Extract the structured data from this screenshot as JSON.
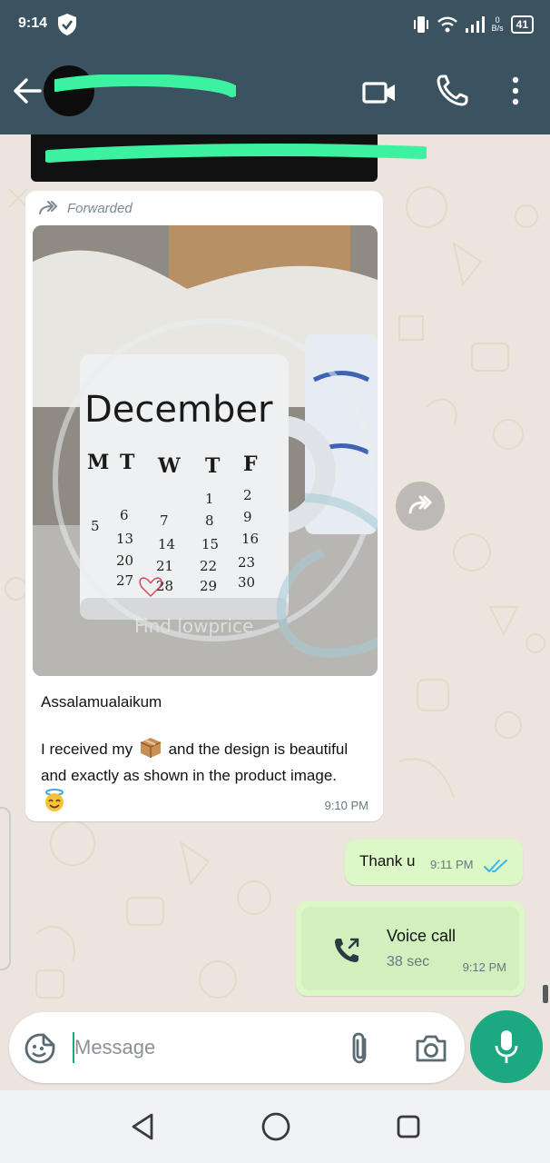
{
  "status_bar": {
    "time": "9:14",
    "network_speed_value": "0",
    "network_speed_unit": "B/s",
    "battery": "41"
  },
  "header": {
    "contact_name": "[redacted]",
    "icons": [
      "back-arrow-icon",
      "video-call-icon",
      "voice-call-icon",
      "more-options-icon"
    ]
  },
  "messages": [
    {
      "direction": "incoming",
      "forwarded_label": "Forwarded",
      "image": {
        "description": "mug-photo",
        "mug_text": "December",
        "calendar_weekdays": [
          "M",
          "T",
          "W",
          "T",
          "F"
        ],
        "calendar_rows": [
          [
            "",
            "",
            "",
            "1",
            "2"
          ],
          [
            "5",
            "6",
            "7",
            "8",
            "9"
          ],
          [
            "13",
            "",
            "14",
            "15",
            "16"
          ],
          [
            "20",
            "",
            "21",
            "22",
            "23"
          ],
          [
            "27",
            "",
            "28",
            "29",
            "30"
          ]
        ],
        "watermark_text": "Find lowprice"
      },
      "greeting": "Assalamualaikum",
      "body_before_emoji": "I received my",
      "body_after_emoji": "and the design is beautiful and exactly as shown in the product image.",
      "time": "9:10 PM"
    },
    {
      "direction": "outgoing",
      "text": "Thank u",
      "time": "9:11 PM",
      "status": "read"
    },
    {
      "direction": "outgoing",
      "type": "voice_call",
      "title": "Voice call",
      "duration": "38 sec",
      "time": "9:12 PM"
    }
  ],
  "composer": {
    "placeholder": "Message"
  },
  "colors": {
    "header_bg": "#3b5260",
    "outgoing_bubble": "#dcf8c6",
    "incoming_bubble": "#ffffff",
    "accent_green": "#1ca880",
    "read_ticks": "#34b7f1"
  }
}
